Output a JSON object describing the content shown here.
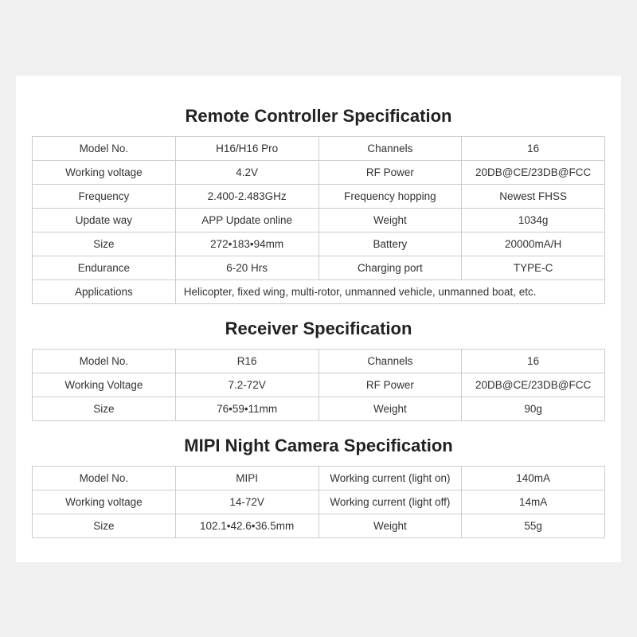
{
  "remote_controller": {
    "title": "Remote Controller Specification",
    "rows": [
      [
        {
          "label": "Model No.",
          "value": "H16/H16 Pro"
        },
        {
          "label": "Channels",
          "value": "16"
        }
      ],
      [
        {
          "label": "Working voltage",
          "value": "4.2V"
        },
        {
          "label": "RF Power",
          "value": "20DB@CE/23DB@FCC"
        }
      ],
      [
        {
          "label": "Frequency",
          "value": "2.400-2.483GHz"
        },
        {
          "label": "Frequency hopping",
          "value": "Newest FHSS"
        }
      ],
      [
        {
          "label": "Update way",
          "value": "APP Update online"
        },
        {
          "label": "Weight",
          "value": "1034g"
        }
      ],
      [
        {
          "label": "Size",
          "value": "272•183•94mm"
        },
        {
          "label": "Battery",
          "value": "20000mA/H"
        }
      ],
      [
        {
          "label": "Endurance",
          "value": "6-20 Hrs"
        },
        {
          "label": "Charging port",
          "value": "TYPE-C"
        }
      ],
      [
        {
          "label": "Applications",
          "value": "Helicopter, fixed wing, multi-rotor, unmanned vehicle, unmanned boat, etc.",
          "wide": true
        }
      ]
    ]
  },
  "receiver": {
    "title": "Receiver Specification",
    "rows": [
      [
        {
          "label": "Model No.",
          "value": "R16"
        },
        {
          "label": "Channels",
          "value": "16"
        }
      ],
      [
        {
          "label": "Working Voltage",
          "value": "7.2-72V"
        },
        {
          "label": "RF Power",
          "value": "20DB@CE/23DB@FCC"
        }
      ],
      [
        {
          "label": "Size",
          "value": "76•59•11mm"
        },
        {
          "label": "Weight",
          "value": "90g"
        }
      ]
    ]
  },
  "camera": {
    "title": "MIPI Night Camera Specification",
    "rows": [
      [
        {
          "label": "Model No.",
          "value": "MIPI"
        },
        {
          "label": "Working current (light on)",
          "value": "140mA"
        }
      ],
      [
        {
          "label": "Working voltage",
          "value": "14-72V"
        },
        {
          "label": "Working current (light off)",
          "value": "14mA"
        }
      ],
      [
        {
          "label": "Size",
          "value": "102.1•42.6•36.5mm"
        },
        {
          "label": "Weight",
          "value": "55g"
        }
      ]
    ]
  }
}
